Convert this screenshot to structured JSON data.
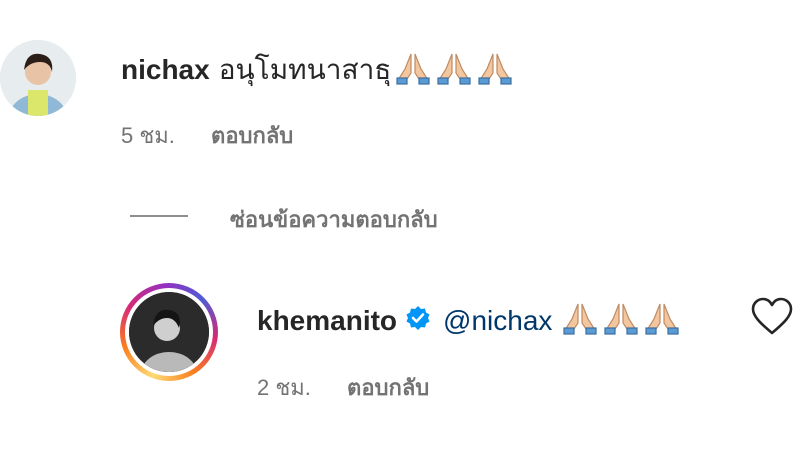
{
  "comment1": {
    "username": "nichax",
    "text": "อนุโมทนาสาธุ",
    "emoji": "🙏🙏🙏",
    "time": "5 ชม.",
    "reply_label": "ตอบกลับ"
  },
  "hide_replies_label": "ซ่อนข้อความตอบกลับ",
  "comment2": {
    "username": "khemanito",
    "mention": "@nichax",
    "emoji": "🙏🙏🙏",
    "time": "2 ชม.",
    "reply_label": "ตอบกลับ"
  },
  "colors": {
    "mention": "#00376b",
    "verified": "#0095f6",
    "meta": "#737373"
  }
}
